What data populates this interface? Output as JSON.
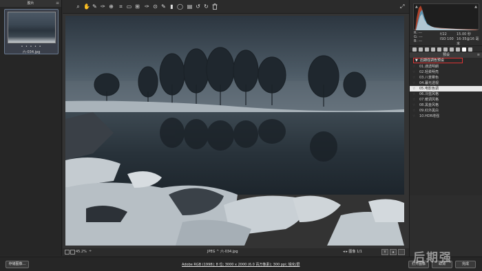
{
  "filmstrip": {
    "title": "胶片",
    "close": "≡",
    "thumb_stars": "• • • • •",
    "thumb_name": "六-034.jpg"
  },
  "toolbar": {
    "tools": [
      "zoom-icon",
      "hand-icon",
      "white-balance-icon",
      "color-sampler-icon",
      "target-adjust-icon",
      "crop-icon",
      "straighten-icon",
      "transform-icon",
      "spot-removal-icon",
      "red-eye-icon",
      "adjustment-brush-icon",
      "graduated-filter-icon",
      "radial-filter-icon",
      "preferences-icon",
      "rotate-left-icon",
      "rotate-right-icon",
      "trash-icon"
    ],
    "tool_glyphs": [
      "⌕",
      "✋",
      "✎",
      "✑",
      "⊕",
      "⌗",
      "▭",
      "⊞",
      "✑",
      "⊙",
      "✎",
      "▮",
      "◯",
      "▤",
      "↺",
      "↻",
      "🗑"
    ],
    "fullscreen_glyph": "⤢"
  },
  "histogram": {
    "warn_left": "▲",
    "warn_right": "▲",
    "r_label": "R:",
    "g_label": "G:",
    "b_label": "B:",
    "r_value": "---",
    "g_value": "---",
    "b_value": "---",
    "aperture": "f/22",
    "shutter": "15.00 秒",
    "iso": "ISO 100",
    "focal": "16-35@16 毫米"
  },
  "panel": {
    "title": "预设",
    "title_icon": "≡",
    "group_name": "后期强调色预设",
    "group_arrow": "▼",
    "presets": [
      {
        "label": "01.通透明朗",
        "star": "☆"
      },
      {
        "label": "02.轻柔明亮",
        "star": "☆"
      },
      {
        "label": "03.八景雾色",
        "star": "☆"
      },
      {
        "label": "04.暮光透视",
        "star": "☆"
      },
      {
        "label": "05.电影色调",
        "star": "☆"
      },
      {
        "label": "06.冷蓝风格",
        "star": "☆"
      },
      {
        "label": "07.暖调风格",
        "star": "☆"
      },
      {
        "label": "08.黑金风格",
        "star": "☆"
      },
      {
        "label": "09.红外黑白",
        "star": "☆"
      },
      {
        "label": "10.HDR增强",
        "star": "☆"
      }
    ],
    "selected_index": 4
  },
  "bottombar": {
    "zoom": "45.2%",
    "zoom_arrow": "÷",
    "file_info": "JPEG ^  六-034.jpg",
    "nav": "◂ ▸  图像 1/1",
    "view_y": "Y",
    "view_a": "a"
  },
  "footer": {
    "save": "存储图像...",
    "workflow": "Adobe RGB (1998); 8 位; 3000 x 2000 (6.0 百万像素); 300 ppi; 锐化/屏",
    "open": "打开图像",
    "cancel": "取消",
    "done": "完成",
    "watermark": "后期强"
  }
}
